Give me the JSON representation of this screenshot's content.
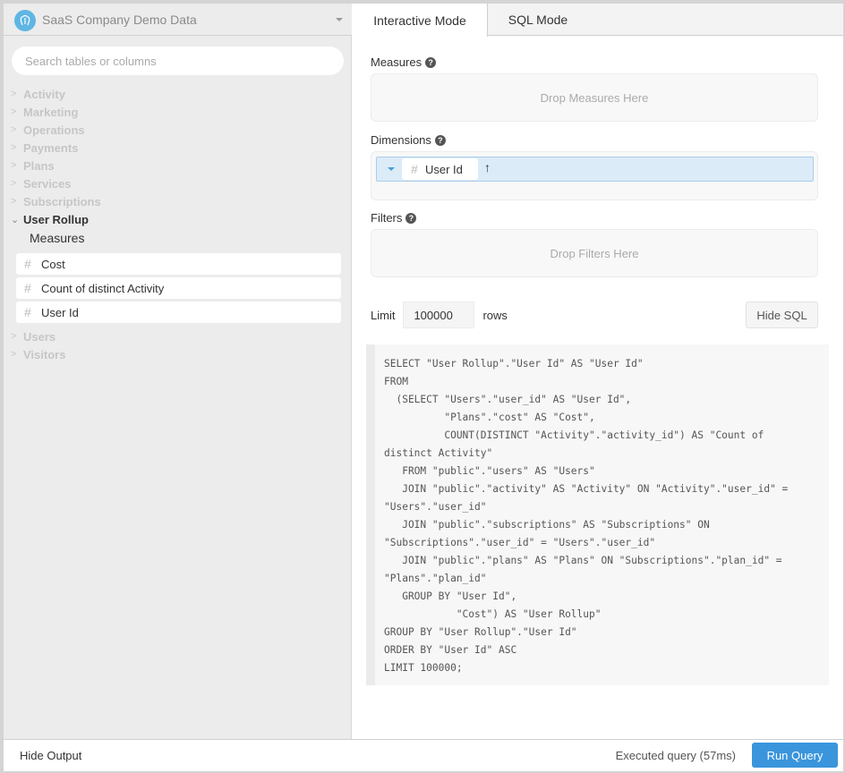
{
  "datasource": {
    "title": "SaaS Company Demo Data",
    "icon": "postgres-elephant-icon"
  },
  "search": {
    "placeholder": "Search tables or columns",
    "value": ""
  },
  "tree": {
    "items_before": [
      "Activity",
      "Marketing",
      "Operations",
      "Payments",
      "Plans",
      "Services",
      "Subscriptions"
    ],
    "expanded": {
      "label": "User Rollup",
      "section_label": "Measures",
      "fields": [
        "Cost",
        "Count of distinct Activity",
        "User Id"
      ]
    },
    "items_after": [
      "Users",
      "Visitors"
    ]
  },
  "tabs": [
    {
      "label": "Interactive Mode",
      "active": true
    },
    {
      "label": "SQL Mode",
      "active": false
    }
  ],
  "measures": {
    "label": "Measures",
    "placeholder": "Drop Measures Here"
  },
  "dimensions": {
    "label": "Dimensions",
    "items": [
      {
        "label": "User Id",
        "sort": "↑"
      }
    ]
  },
  "filters": {
    "label": "Filters",
    "placeholder": "Drop Filters Here"
  },
  "limit": {
    "label": "Limit",
    "value": "100000",
    "suffix": "rows"
  },
  "hide_sql_label": "Hide SQL",
  "sql": "SELECT \"User Rollup\".\"User Id\" AS \"User Id\"\nFROM\n  (SELECT \"Users\".\"user_id\" AS \"User Id\",\n          \"Plans\".\"cost\" AS \"Cost\",\n          COUNT(DISTINCT \"Activity\".\"activity_id\") AS \"Count of\ndistinct Activity\"\n   FROM \"public\".\"users\" AS \"Users\"\n   JOIN \"public\".\"activity\" AS \"Activity\" ON \"Activity\".\"user_id\" =\n\"Users\".\"user_id\"\n   JOIN \"public\".\"subscriptions\" AS \"Subscriptions\" ON\n\"Subscriptions\".\"user_id\" = \"Users\".\"user_id\"\n   JOIN \"public\".\"plans\" AS \"Plans\" ON \"Subscriptions\".\"plan_id\" =\n\"Plans\".\"plan_id\"\n   GROUP BY \"User Id\",\n            \"Cost\") AS \"User Rollup\"\nGROUP BY \"User Rollup\".\"User Id\"\nORDER BY \"User Id\" ASC\nLIMIT 100000;",
  "footer": {
    "hide_output_label": "Hide Output",
    "status": "Executed query (57ms)",
    "run_label": "Run Query"
  },
  "colors": {
    "accent": "#3a95dc",
    "logo": "#5fb6e3",
    "dimension_pill": "#dcebf8"
  }
}
